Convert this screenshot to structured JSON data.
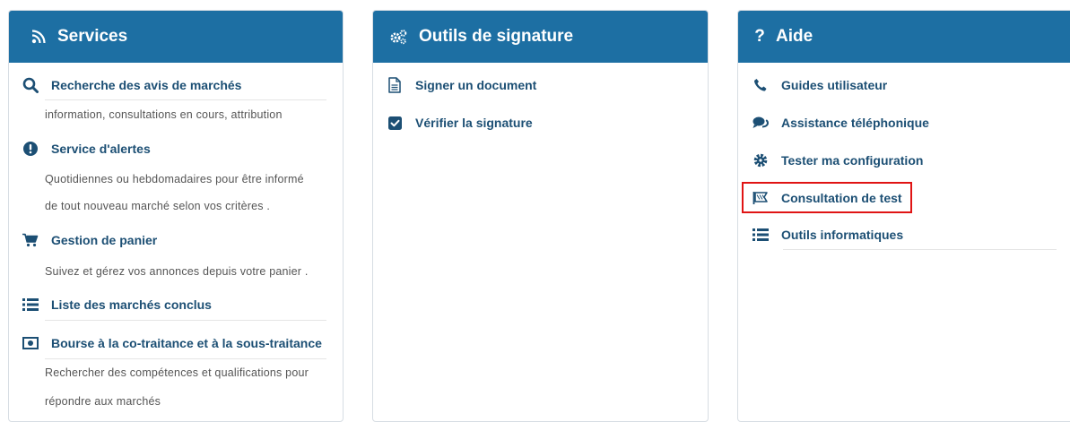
{
  "services": {
    "title": "Services",
    "items": [
      {
        "label": "Recherche des avis de marchés",
        "desc": [
          "information, consultations en cours, attribution"
        ]
      },
      {
        "label": "Service d'alertes",
        "desc": [
          "Quotidiennes ou hebdomadaires pour être informé",
          "de tout nouveau marché selon vos critères ."
        ]
      },
      {
        "label": "Gestion de panier",
        "desc": [
          "Suivez et gérez vos annonces depuis votre panier ."
        ]
      },
      {
        "label": "Liste des marchés conclus",
        "desc": []
      },
      {
        "label": "Bourse à la co-traitance et à la sous-traitance",
        "desc": [
          "Rechercher des compétences et qualifications pour",
          "répondre aux marchés"
        ]
      }
    ]
  },
  "signature": {
    "title": "Outils de signature",
    "items": [
      {
        "label": "Signer un document"
      },
      {
        "label": "Vérifier la signature"
      }
    ]
  },
  "aide": {
    "title": "Aide",
    "items": [
      {
        "label": "Guides utilisateur"
      },
      {
        "label": "Assistance téléphonique"
      },
      {
        "label": "Tester ma configuration"
      },
      {
        "label": "Consultation de test"
      },
      {
        "label": "Outils informatiques"
      }
    ]
  },
  "colors": {
    "header": "#1d6fa3",
    "link": "#1c4f74",
    "highlight": "#e01414"
  },
  "icons": {
    "services_header": "rss-icon",
    "signature_header": "cogs-icon",
    "aide_header": "question-icon",
    "services_items": [
      "search-icon",
      "exclamation-circle-icon",
      "cart-icon",
      "list-icon",
      "money-icon"
    ],
    "signature_items": [
      "document-icon",
      "checkbox-icon"
    ],
    "aide_items": [
      "phone-icon",
      "chat-icon",
      "gear-icon",
      "flag-icon",
      "list-icon"
    ]
  }
}
